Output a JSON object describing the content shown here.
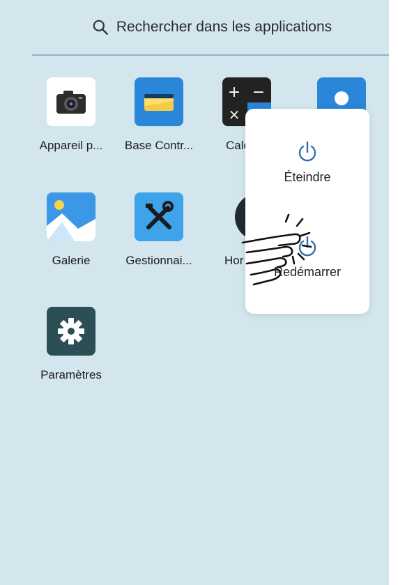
{
  "search": {
    "placeholder_text": "Rechercher dans les applications",
    "icon": "search-icon"
  },
  "apps": [
    {
      "label": "Appareil p...",
      "icon": "camera-icon"
    },
    {
      "label": "Base Contr...",
      "icon": "base-contr-icon"
    },
    {
      "label": "Calc",
      "icon": "calculator-icon"
    },
    {
      "label": "",
      "icon": "contacts-icon"
    },
    {
      "label": "Galerie",
      "icon": "gallery-icon"
    },
    {
      "label": "Gestionnai...",
      "icon": "tools-icon"
    },
    {
      "label": "Hor",
      "icon": "clock-icon"
    },
    {
      "label": "Paramètres",
      "icon": "settings-gear-icon"
    }
  ],
  "power_menu": {
    "items": [
      {
        "label": "Éteindre",
        "icon": "power-icon"
      },
      {
        "label": "Redémarrer",
        "icon": "restart-icon"
      }
    ]
  },
  "colors": {
    "background": "#d3e6ee",
    "accent": "#2f6fae",
    "divider": "#8fb5c2"
  }
}
